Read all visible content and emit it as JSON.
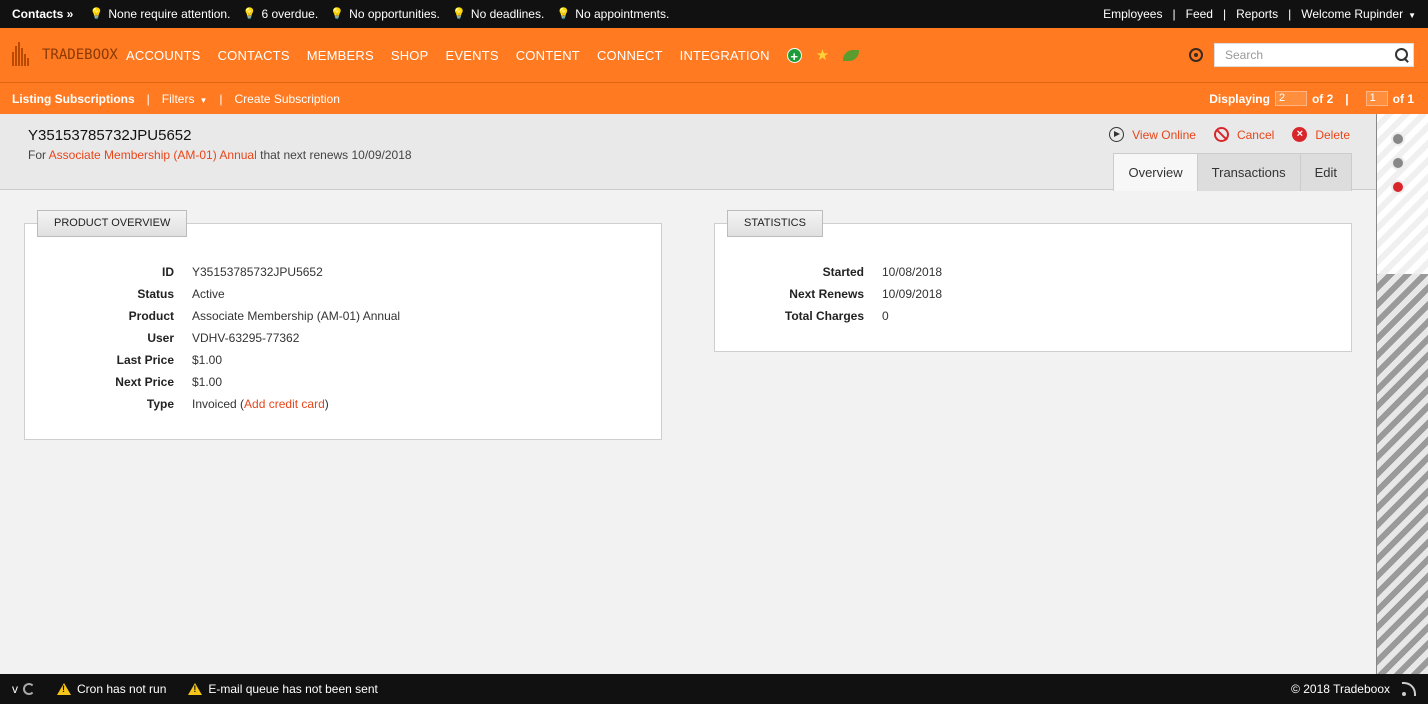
{
  "topbar": {
    "context": "Contacts »",
    "notices": [
      {
        "icon": "bulb-off-icon",
        "text": "None require attention."
      },
      {
        "icon": "bulb-on-icon",
        "text": "6 overdue."
      },
      {
        "icon": "bulb-off-icon",
        "text": "No opportunities."
      },
      {
        "icon": "bulb-off-icon",
        "text": "No deadlines."
      },
      {
        "icon": "bulb-off-icon",
        "text": "No appointments."
      }
    ],
    "links": [
      "Employees",
      "Feed",
      "Reports"
    ],
    "welcome": "Welcome Rupinder"
  },
  "navbar": {
    "logo": "TRADEBOOX",
    "items": [
      "ACCOUNTS",
      "CONTACTS",
      "MEMBERS",
      "SHOP",
      "EVENTS",
      "CONTENT",
      "CONNECT",
      "INTEGRATION"
    ],
    "search_placeholder": "Search"
  },
  "subbar": {
    "listing": "Listing Subscriptions",
    "filters": "Filters",
    "create": "Create Subscription",
    "displaying": "Displaying",
    "display_count": "2",
    "of_total": "of 2",
    "page": "1",
    "of_pages": "of 1"
  },
  "header": {
    "title": "Y35153785732JPU5652",
    "subtitle_prefix": "For",
    "subtitle_link": "Associate Membership (AM-01) Annual",
    "subtitle_suffix": "that next renews 10/09/2018",
    "actions": {
      "view_online": "View Online",
      "cancel": "Cancel",
      "delete": "Delete"
    },
    "tabs": [
      "Overview",
      "Transactions",
      "Edit"
    ]
  },
  "product_overview": {
    "legend": "PRODUCT OVERVIEW",
    "rows": [
      {
        "label": "ID",
        "value": "Y35153785732JPU5652"
      },
      {
        "label": "Status",
        "value": "Active"
      },
      {
        "label": "Product",
        "value": "Associate Membership (AM-01) Annual",
        "link": true
      },
      {
        "label": "User",
        "value": "VDHV-63295-77362",
        "link": true
      },
      {
        "label": "Last Price",
        "value": "$1.00"
      },
      {
        "label": "Next Price",
        "value": "$1.00"
      },
      {
        "label": "Type",
        "value": "Invoiced",
        "link_text": "Add credit card"
      }
    ]
  },
  "statistics": {
    "legend": "STATISTICS",
    "rows": [
      {
        "label": "Started",
        "value": "10/08/2018"
      },
      {
        "label": "Next Renews",
        "value": "10/09/2018"
      },
      {
        "label": "Total Charges",
        "value": "0"
      }
    ]
  },
  "footer": {
    "version": "v",
    "messages": [
      "Cron has not run",
      "E-mail queue has not been sent"
    ],
    "copyright": "© 2018 Tradeboox"
  },
  "colors": {
    "brand_orange": "#ff7a21",
    "link": "#e8461a",
    "danger": "#d9262a"
  }
}
